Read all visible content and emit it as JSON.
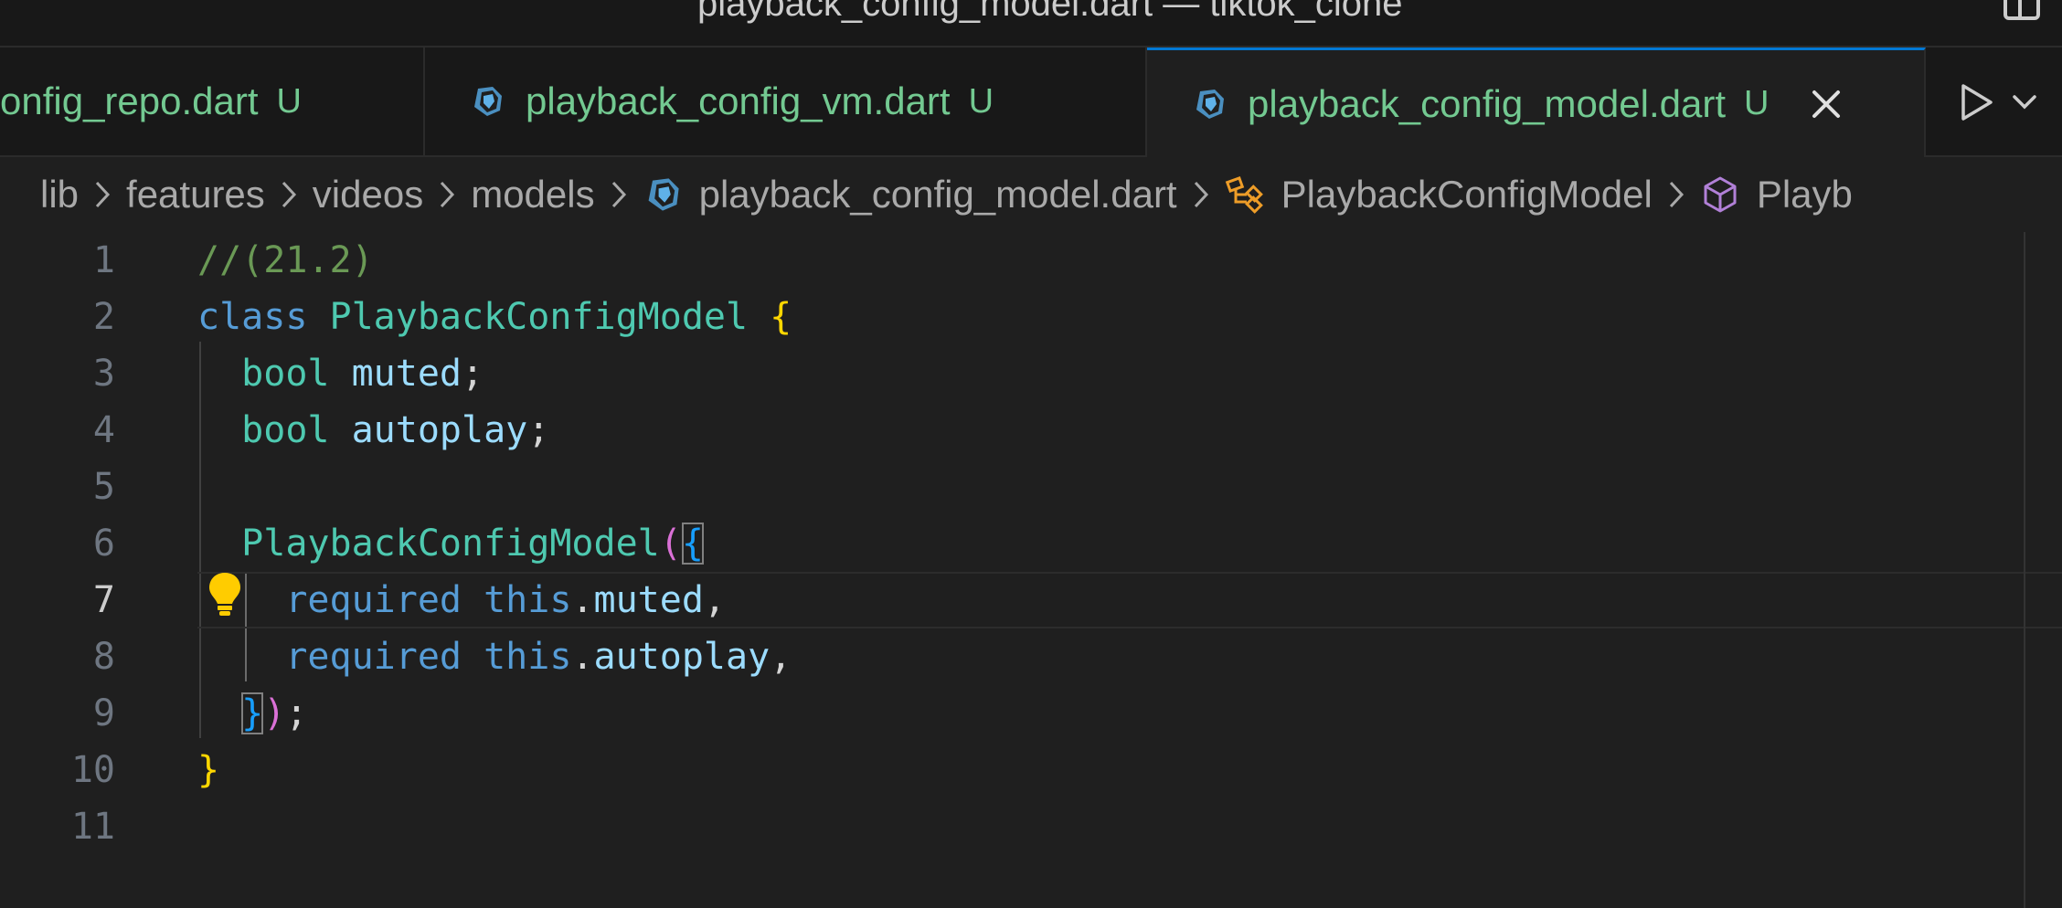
{
  "window": {
    "title": "playback_config_model.dart — tiktok_clone"
  },
  "tabs": [
    {
      "name": "config_repo.dart",
      "display": "onfig_repo.dart",
      "badge": "U",
      "active": false,
      "icon": "dart-icon"
    },
    {
      "name": "playback_config_vm.dart",
      "display": "playback_config_vm.dart",
      "badge": "U",
      "active": false,
      "icon": "dart-icon"
    },
    {
      "name": "playback_config_model.dart",
      "display": "playback_config_model.dart",
      "badge": "U",
      "active": true,
      "icon": "dart-icon"
    }
  ],
  "breadcrumb": {
    "items": [
      "lib",
      "features",
      "videos",
      "models",
      "playback_config_model.dart",
      "PlaybackConfigModel",
      "Playb"
    ],
    "icons": {
      "file": "dart-icon",
      "class": "class-symbol-icon",
      "field": "field-symbol-icon"
    }
  },
  "editor": {
    "current_line": 7,
    "lines": [
      {
        "n": "1",
        "text": "//(21.2)"
      },
      {
        "n": "2",
        "text": "class PlaybackConfigModel {"
      },
      {
        "n": "3",
        "text": "  bool muted;"
      },
      {
        "n": "4",
        "text": "  bool autoplay;"
      },
      {
        "n": "5",
        "text": ""
      },
      {
        "n": "6",
        "text": "  PlaybackConfigModel({"
      },
      {
        "n": "7",
        "text": "    required this.muted,"
      },
      {
        "n": "8",
        "text": "    required this.autoplay,"
      },
      {
        "n": "9",
        "text": "  });"
      },
      {
        "n": "10",
        "text": "}"
      },
      {
        "n": "11",
        "text": ""
      }
    ]
  },
  "colors": {
    "editor_bg": "#1f1f1f",
    "tab_modified": "#73c991",
    "active_tab_border": "#0078d4",
    "keyword": "#569cd6",
    "type": "#4ec9b0",
    "variable": "#9cdcfe",
    "comment": "#6a9955",
    "bracket_level1": "#ffd700",
    "bracket_level2": "#da70d6",
    "bracket_level3": "#179fff"
  }
}
